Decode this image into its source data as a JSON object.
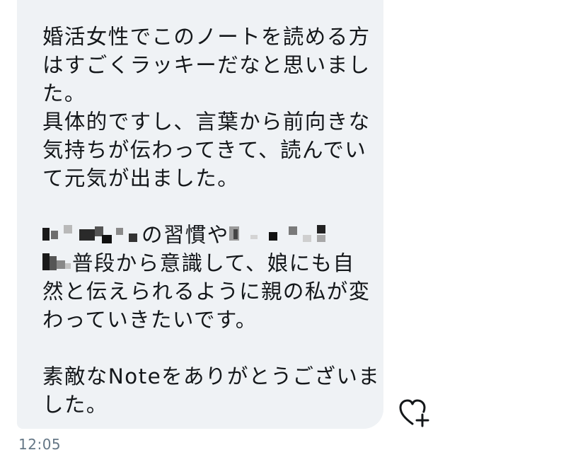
{
  "message": {
    "lines": [
      "婚活女性でこのノートを読める方",
      "はすごくラッキーだなと思いまし",
      "た。",
      "具体的ですし、言葉から前向きな",
      "気持ちが伝わってきて、読んでい",
      "て元気が出ました。",
      "",
      "の習慣や",
      "普段から意識して、娘にも自",
      "然と伝えられるように親の私が変",
      "わっていきたいです。",
      "",
      "素敵なNoteをありがとうございま",
      "した。"
    ]
  },
  "timestamp": "12:05",
  "icons": {
    "like": "heart-plus-icon"
  },
  "colors": {
    "bubble": "#eff2f5",
    "text": "#14171a",
    "timestamp": "#657786",
    "icon": "#14171a"
  }
}
